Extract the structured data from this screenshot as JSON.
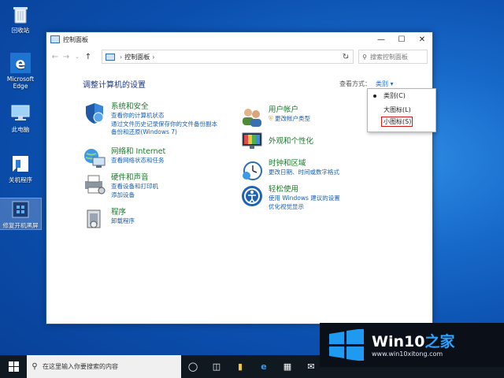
{
  "desktop": {
    "icons": [
      {
        "label": "回收站"
      },
      {
        "label": "Microsoft\nEdge"
      },
      {
        "label": "此电脑"
      },
      {
        "label": "关机程序"
      },
      {
        "label": "修复开机黑屏"
      }
    ]
  },
  "window": {
    "title": "控制面板",
    "address": {
      "root": "控制面板"
    },
    "search_placeholder": "搜索控制面板",
    "page_title": "调整计算机的设置",
    "view_by_label": "查看方式：",
    "view_by_value": "类别 ▾",
    "categories": {
      "system": {
        "title": "系统和安全",
        "links": [
          "查看你的计算机状态",
          "通过文件历史记录保存你的文件备份副本",
          "备份和还原(Windows 7)"
        ]
      },
      "network": {
        "title": "网络和 Internet",
        "links": [
          "查看网络状态和任务"
        ]
      },
      "hardware": {
        "title": "硬件和声音",
        "links": [
          "查看设备和打印机",
          "添加设备"
        ]
      },
      "programs": {
        "title": "程序",
        "links": [
          "卸载程序"
        ]
      },
      "user": {
        "title": "用户帐户",
        "links": [
          "更改帐户类型"
        ]
      },
      "appearance": {
        "title": "外观和个性化",
        "links": []
      },
      "clock": {
        "title": "时钟和区域",
        "links": [
          "更改日期、时间或数字格式"
        ]
      },
      "ease": {
        "title": "轻松使用",
        "links": [
          "使用 Windows 建议的设置",
          "优化视觉显示"
        ]
      }
    },
    "view_menu": {
      "items": [
        "类别(C)",
        "大图标(L)",
        "小图标(S)"
      ],
      "selected_index": 0,
      "highlighted_index": 2
    }
  },
  "taskbar": {
    "search_placeholder": "在这里输入你要搜索的内容"
  },
  "watermark": {
    "brand_latin": "Win10",
    "brand_cn": "之家",
    "url": "www.win10xitong.com"
  },
  "colors": {
    "accent": "#1a6ccf",
    "category_title": "#1a7a2a",
    "link": "#1a5fb4",
    "highlight_box": "#d41818"
  }
}
